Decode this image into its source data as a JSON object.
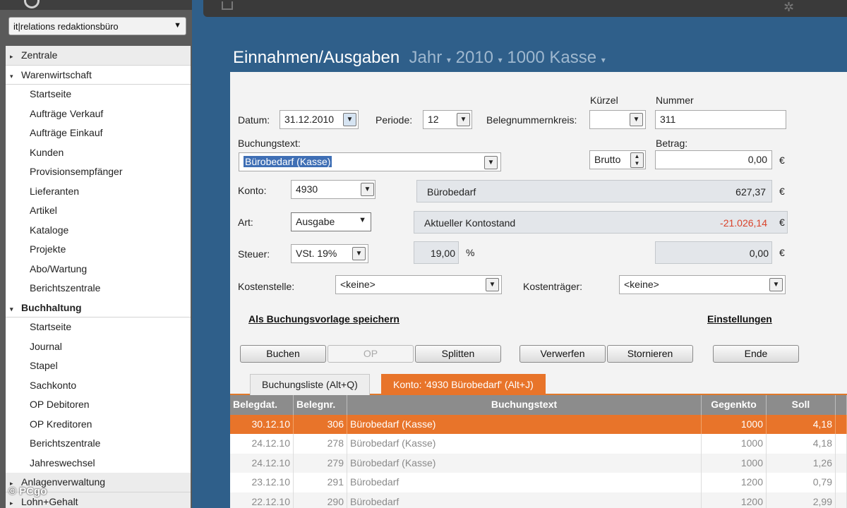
{
  "sidebar": {
    "company": "it|relations redaktionsbüro",
    "items": [
      {
        "label": "Zentrale",
        "kind": "group",
        "marker": "▸"
      },
      {
        "label": "Warenwirtschaft",
        "kind": "group-open",
        "marker": "▾"
      },
      {
        "label": "Startseite",
        "kind": "sub"
      },
      {
        "label": "Aufträge Verkauf",
        "kind": "sub"
      },
      {
        "label": "Aufträge Einkauf",
        "kind": "sub"
      },
      {
        "label": "Kunden",
        "kind": "sub"
      },
      {
        "label": "Provisionsempfänger",
        "kind": "sub"
      },
      {
        "label": "Lieferanten",
        "kind": "sub"
      },
      {
        "label": "Artikel",
        "kind": "sub"
      },
      {
        "label": "Kataloge",
        "kind": "sub"
      },
      {
        "label": "Projekte",
        "kind": "sub"
      },
      {
        "label": "Abo/Wartung",
        "kind": "sub"
      },
      {
        "label": "Berichtszentrale",
        "kind": "sub"
      },
      {
        "label": "Buchhaltung",
        "kind": "group-open-bold",
        "marker": "▾"
      },
      {
        "label": "Startseite",
        "kind": "sub"
      },
      {
        "label": "Journal",
        "kind": "sub"
      },
      {
        "label": "Stapel",
        "kind": "sub"
      },
      {
        "label": "Sachkonto",
        "kind": "sub"
      },
      {
        "label": "OP Debitoren",
        "kind": "sub"
      },
      {
        "label": "OP Kreditoren",
        "kind": "sub"
      },
      {
        "label": "Berichtszentrale",
        "kind": "sub"
      },
      {
        "label": "Jahreswechsel",
        "kind": "sub"
      },
      {
        "label": "Anlagenverwaltung",
        "kind": "group",
        "marker": "▸"
      },
      {
        "label": "Lohn+Gehalt",
        "kind": "group",
        "marker": "▸"
      }
    ]
  },
  "watermark": "© PCgo",
  "title": {
    "main": "Einnahmen/Ausgaben",
    "crumb1": "Jahr",
    "crumb2": "2010",
    "crumb3": "1000 Kasse",
    "sep": "▾"
  },
  "form": {
    "datum_label": "Datum:",
    "datum_value": "31.12.2010",
    "periode_label": "Periode:",
    "periode_value": "12",
    "belegnummernkreis_label": "Belegnummernkreis:",
    "kuerzel_label": "Kürzel",
    "kuerzel_value": "",
    "nummer_label": "Nummer",
    "nummer_value": "311",
    "buchungstext_label": "Buchungstext:",
    "buchungstext_value": "Bürobedarf (Kasse)",
    "brutto_value": "Brutto",
    "betrag_label": "Betrag:",
    "betrag_value": "0,00",
    "konto_label": "Konto:",
    "konto_value": "4930",
    "konto_name": "Bürobedarf",
    "konto_amount": "627,37",
    "art_label": "Art:",
    "art_value": "Ausgabe",
    "kontostand_label": "Aktueller Kontostand",
    "kontostand_value": "-21.026,14",
    "steuer_label": "Steuer:",
    "steuer_value": "VSt. 19%",
    "steuer_rate": "19,00",
    "percent": "%",
    "steuer_amount": "0,00",
    "kostenstelle_label": "Kostenstelle:",
    "kostenstelle_value": "<keine>",
    "kostentraeger_label": "Kostenträger:",
    "kostentraeger_value": "<keine>",
    "currency": "€",
    "save_template_link": "Als Buchungsvorlage speichern",
    "settings_link": "Einstellungen"
  },
  "buttons": {
    "buchen": "Buchen",
    "op": "OP",
    "splitten": "Splitten",
    "verwerfen": "Verwerfen",
    "stornieren": "Stornieren",
    "ende": "Ende"
  },
  "tabs": {
    "buchungsliste": "Buchungsliste (Alt+Q)",
    "konto": "Konto: '4930 Bürobedarf' (Alt+J)"
  },
  "table": {
    "columns": [
      "Belegdat.",
      "Belegnr.",
      "Buchungstext",
      "Gegenkto",
      "Soll"
    ],
    "rows": [
      {
        "date": "30.12.10",
        "nr": "306",
        "text": "Bürobedarf (Kasse)",
        "gegenkto": "1000",
        "soll": "4,18"
      },
      {
        "date": "24.12.10",
        "nr": "278",
        "text": "Bürobedarf (Kasse)",
        "gegenkto": "1000",
        "soll": "4,18"
      },
      {
        "date": "24.12.10",
        "nr": "279",
        "text": "Bürobedarf (Kasse)",
        "gegenkto": "1000",
        "soll": "1,26"
      },
      {
        "date": "23.12.10",
        "nr": "291",
        "text": "Bürobedarf",
        "gegenkto": "1200",
        "soll": "0,79"
      },
      {
        "date": "22.12.10",
        "nr": "290",
        "text": "Bürobedarf",
        "gegenkto": "1200",
        "soll": "2,99"
      }
    ]
  },
  "colors": {
    "accent": "#e8742a",
    "background": "#2f5f8a",
    "negative": "#d9432b"
  }
}
